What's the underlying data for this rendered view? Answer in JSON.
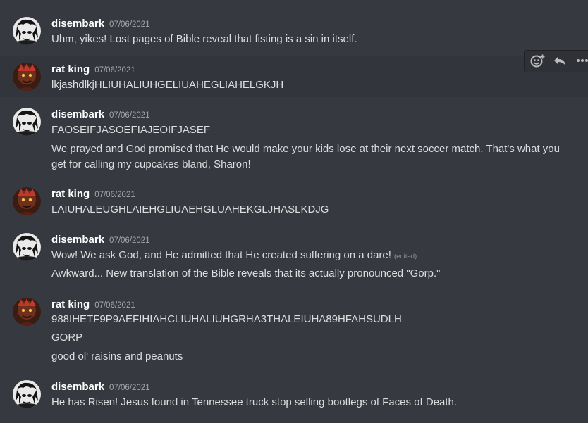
{
  "messages": [
    {
      "author": "disembark",
      "timestamp": "07/06/2021",
      "lines": [
        "Uhm, yikes! Lost pages of Bible reveal that fisting is a sin in itself."
      ]
    },
    {
      "author": "rat king",
      "timestamp": "07/06/2021",
      "lines": [
        "lkjashdlkjHLIUHALIUHGELIUAHEGLIAHELGKJH"
      ]
    },
    {
      "author": "disembark",
      "timestamp": "07/06/2021",
      "lines": [
        "FAOSEIFJASOEFIAJEOIFJASEF",
        "We prayed and God promised that He would make your kids lose at their next soccer match. That's what you",
        "get for calling my cupcakes bland, Sharon!"
      ]
    },
    {
      "author": "rat king",
      "timestamp": "07/06/2021",
      "lines": [
        "LAIUHALEUGHLAIEHGLIUAEHGLUAHEKGLJHASLKDJG"
      ]
    },
    {
      "author": "disembark",
      "timestamp": "07/06/2021",
      "lines": [
        "Wow! We ask God, and He admitted that He created suffering on a dare!",
        "Awkward... New translation of the Bible reveals that its actually pronounced \"Gorp.\""
      ],
      "edited_label": "(edited)"
    },
    {
      "author": "rat king",
      "timestamp": "07/06/2021",
      "lines": [
        "988IHETF9P9AEFIHIAHCLIUHALIUHGRHA3THALEIUHA89HFAHSUDLH",
        "GORP",
        "good ol' raisins and peanuts"
      ]
    },
    {
      "author": "disembark",
      "timestamp": "07/06/2021",
      "lines": [
        "He has Risen! Jesus found in Tennessee truck stop selling bootlegs of Faces of Death."
      ]
    }
  ],
  "toolbar": {
    "icons": [
      "add-reaction-icon",
      "reply-icon",
      "more-icon"
    ]
  },
  "colors": {
    "background": "#36393f",
    "hover_background": "#32353b",
    "username": "#ffffff",
    "message_text": "#dcddde",
    "timestamp": "#a3a6aa",
    "toolbar_background": "#2f3136"
  }
}
